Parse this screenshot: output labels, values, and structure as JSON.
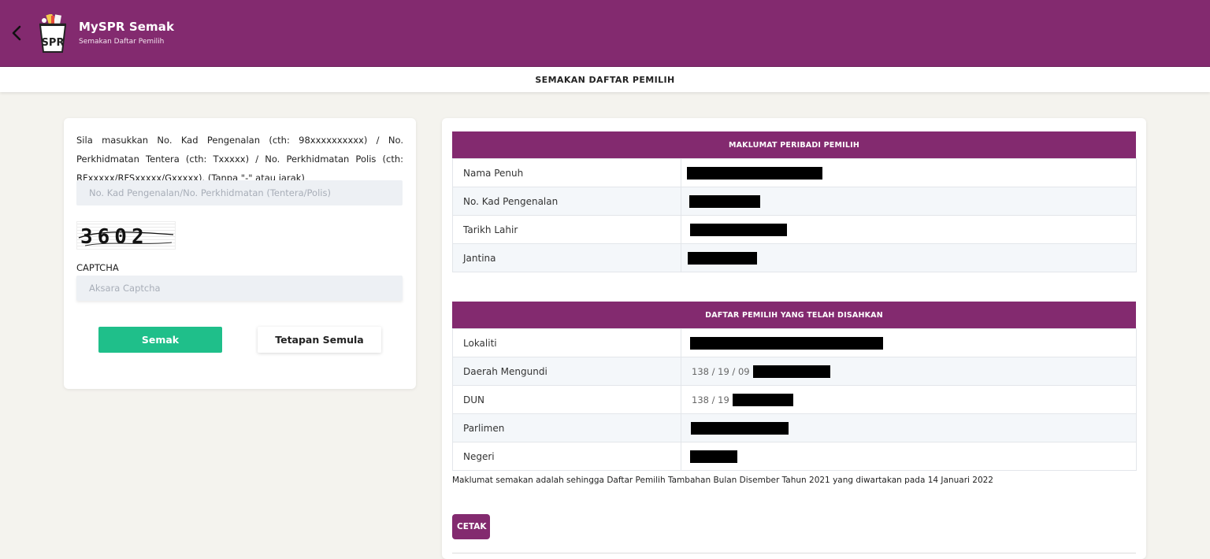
{
  "header": {
    "app_title": "MySPR Semak",
    "app_subtitle": "Semakan Daftar Pemilih",
    "page_title": "SEMAKAN DAFTAR PEMILIH",
    "logo_text": "SPR",
    "brand_color": "#832a6f"
  },
  "form": {
    "instructions": "Sila masukkan No. Kad Pengenalan (cth: 98xxxxxxxxxx) / No. Perkhidmatan Tentera (cth: Txxxxx) / No. Perkhidmatan Polis (cth: RFxxxxx/RFSxxxxx/Gxxxxx). (Tanpa \"-\" atau jarak)",
    "ic_placeholder": "No. Kad Pengenalan/No. Perkhidmatan (Tentera/Polis)",
    "ic_value": "",
    "captcha_text": "3602",
    "captcha_label": "CAPTCHA",
    "captcha_placeholder": "Aksara Captcha",
    "captcha_value": "",
    "submit_label": "Semak",
    "reset_label": "Tetapan Semula",
    "submit_color": "#1fbf8a"
  },
  "personal": {
    "heading": "MAKLUMAT PERIBADI PEMILIH",
    "rows": [
      {
        "label": "Nama Penuh",
        "prefix": "",
        "redacted": true
      },
      {
        "label": "No. Kad Pengenalan",
        "prefix": "",
        "redacted": true
      },
      {
        "label": "Tarikh Lahir",
        "prefix": "",
        "redacted": true
      },
      {
        "label": "Jantina",
        "prefix": "",
        "redacted": true
      }
    ]
  },
  "registry": {
    "heading": "DAFTAR PEMILIH YANG TELAH DISAHKAN",
    "rows": [
      {
        "label": "Lokaliti",
        "prefix": "",
        "redacted": true
      },
      {
        "label": "Daerah Mengundi",
        "prefix": "138 / 19 / 09",
        "redacted": true
      },
      {
        "label": "DUN",
        "prefix": "138 / 19",
        "redacted": true
      },
      {
        "label": "Parlimen",
        "prefix": "",
        "redacted": true
      },
      {
        "label": "Negeri",
        "prefix": "",
        "redacted": true
      }
    ]
  },
  "note": "Maklumat semakan adalah sehingga Daftar Pemilih Tambahan Bulan Disember Tahun 2021 yang diwartakan pada 14 Januari 2022",
  "print_label": "CETAK"
}
